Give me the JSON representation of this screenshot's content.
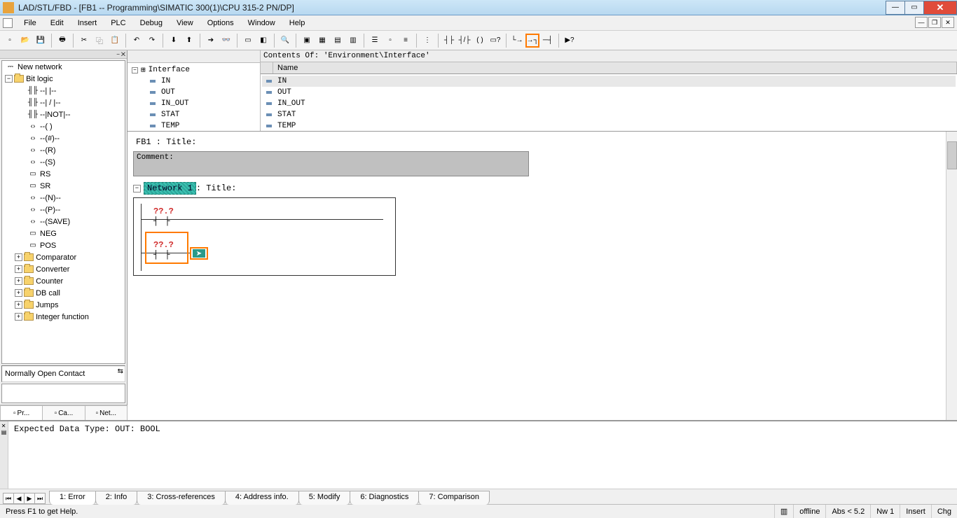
{
  "window": {
    "title": "LAD/STL/FBD  - [FB1 -- Programming\\SIMATIC 300(1)\\CPU 315-2 PN/DP]"
  },
  "menu": {
    "items": [
      "File",
      "Edit",
      "Insert",
      "PLC",
      "Debug",
      "View",
      "Options",
      "Window",
      "Help"
    ]
  },
  "toolbar_icons": [
    "new-icon",
    "open-icon",
    "save-icon",
    "sep",
    "print-icon",
    "sep",
    "cut-icon",
    "copy-icon",
    "paste-icon",
    "sep",
    "undo-icon",
    "redo-icon",
    "sep",
    "download-icon",
    "upload-icon",
    "sep",
    "goto-icon",
    "monitor-icon",
    "sep",
    "display-icon",
    "bookmark-icon",
    "sep",
    "find-icon",
    "sep",
    "window-icon",
    "tile-icon",
    "cascade-icon",
    "split-icon",
    "sep",
    "catalog-icon",
    "block-icon",
    "network-icon",
    "sep",
    "ref-icon",
    "sep",
    "contact-no-icon",
    "contact-nc-icon",
    "coil-icon",
    "box-icon",
    "sep",
    "branch-open-icon",
    "branch-close-icon",
    "connection-icon",
    "sep",
    "help-icon"
  ],
  "highlighted_tool": "branch-close-icon",
  "element_tree": {
    "top": {
      "label": "New network"
    },
    "open_folder": {
      "label": "Bit logic"
    },
    "bits": [
      "--| |--",
      "--| / |--",
      "--|NOT|--",
      "--( )",
      "--(#)--",
      "--(R)",
      "--(S)",
      "RS",
      "SR",
      "--(N)--",
      "--(P)--",
      "--(SAVE)",
      "NEG",
      "POS"
    ],
    "folders": [
      "Comparator",
      "Converter",
      "Counter",
      "DB call",
      "Jumps",
      "Integer function"
    ],
    "description": "Normally Open Contact",
    "tabs": [
      "Pr...",
      "Ca...",
      "Net..."
    ]
  },
  "interface": {
    "header": "Contents Of: 'Environment\\Interface'",
    "root": "Interface",
    "params": [
      "IN",
      "OUT",
      "IN_OUT",
      "STAT",
      "TEMP"
    ],
    "grid_col": "Name"
  },
  "editor": {
    "block_title": "FB1 : Title:",
    "comment_label": "Comment:",
    "network_label": "Network 1",
    "network_title_suffix": ": Title:",
    "addr1": "??.?",
    "addr2": "??.?"
  },
  "bottom": {
    "message": "Expected Data Type: OUT: BOOL",
    "tabs": [
      "1: Error",
      "2: Info",
      "3: Cross-references",
      "4: Address info.",
      "5: Modify",
      "6: Diagnostics",
      "7: Comparison"
    ]
  },
  "status": {
    "help": "Press F1 to get Help.",
    "offline": "offline",
    "abs": "Abs < 5.2",
    "nw": "Nw 1",
    "insert": "Insert",
    "chg": "Chg"
  }
}
